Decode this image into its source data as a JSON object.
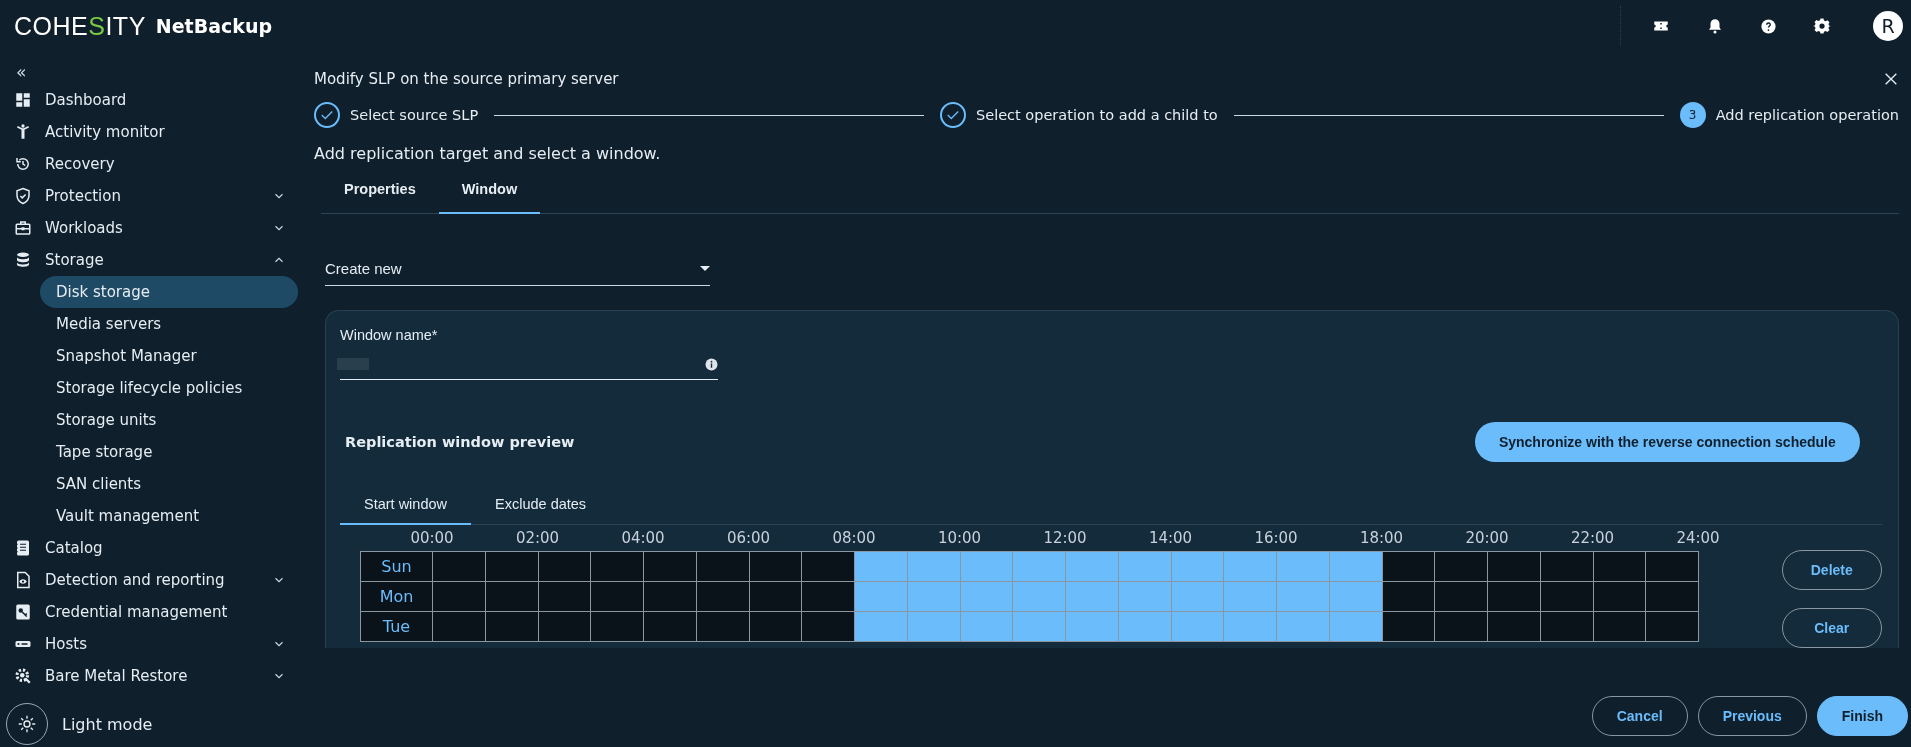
{
  "header": {
    "logo": "COHESITY",
    "product": "NetBackup",
    "avatar": "R"
  },
  "sidebar": {
    "collapse": "«",
    "items": [
      {
        "label": "Dashboard"
      },
      {
        "label": "Activity monitor"
      },
      {
        "label": "Recovery"
      },
      {
        "label": "Protection",
        "expanded": false
      },
      {
        "label": "Workloads",
        "expanded": false
      },
      {
        "label": "Storage",
        "expanded": true,
        "children": [
          {
            "label": "Disk storage",
            "selected": true
          },
          {
            "label": "Media servers",
            "selected": false
          },
          {
            "label": "Snapshot Manager",
            "selected": false
          },
          {
            "label": "Storage lifecycle policies",
            "selected": false
          },
          {
            "label": "Storage units",
            "selected": false
          },
          {
            "label": "Tape storage",
            "selected": false
          },
          {
            "label": "SAN clients",
            "selected": false
          },
          {
            "label": "Vault management",
            "selected": false
          }
        ]
      },
      {
        "label": "Catalog"
      },
      {
        "label": "Detection and reporting",
        "expanded": false
      },
      {
        "label": "Credential management"
      },
      {
        "label": "Hosts",
        "expanded": false
      },
      {
        "label": "Bare Metal Restore",
        "expanded": false
      }
    ],
    "theme_toggle": "Light mode"
  },
  "wizard": {
    "title": "Modify SLP on the source primary server",
    "steps": [
      {
        "label": "Select source SLP",
        "completed": true
      },
      {
        "label": "Select operation to add a child to",
        "completed": true
      },
      {
        "label": "Add replication operation",
        "completed": false,
        "number": "3"
      }
    ],
    "subtitle": "Add replication target and select a window.",
    "tabs": [
      {
        "label": "Properties",
        "selected": false
      },
      {
        "label": "Window",
        "selected": true
      }
    ],
    "window_select": {
      "value": "Create new"
    },
    "window_name": {
      "label": "Window name*"
    },
    "preview_title": "Replication window preview",
    "sync_button": "Synchronize with the reverse connection schedule",
    "inner_tabs": [
      {
        "label": "Start window",
        "selected": true
      },
      {
        "label": "Exclude dates",
        "selected": false
      }
    ],
    "grid": {
      "hours": [
        "00:00",
        "02:00",
        "04:00",
        "06:00",
        "08:00",
        "10:00",
        "12:00",
        "14:00",
        "16:00",
        "18:00",
        "20:00",
        "22:00",
        "24:00"
      ],
      "rows": [
        {
          "day": "Sun",
          "slots": [
            false,
            false,
            false,
            false,
            false,
            false,
            false,
            false,
            true,
            true,
            true,
            true,
            true,
            true,
            true,
            true,
            true,
            true,
            false,
            false,
            false,
            false,
            false,
            false
          ]
        },
        {
          "day": "Mon",
          "slots": [
            false,
            false,
            false,
            false,
            false,
            false,
            false,
            false,
            true,
            true,
            true,
            true,
            true,
            true,
            true,
            true,
            true,
            true,
            false,
            false,
            false,
            false,
            false,
            false
          ]
        },
        {
          "day": "Tue",
          "slots": [
            false,
            false,
            false,
            false,
            false,
            false,
            false,
            false,
            true,
            true,
            true,
            true,
            true,
            true,
            true,
            true,
            true,
            true,
            false,
            false,
            false,
            false,
            false,
            false
          ]
        }
      ]
    },
    "grid_buttons": [
      "Delete",
      "Clear"
    ],
    "footer_buttons": [
      {
        "label": "Cancel",
        "primary": false
      },
      {
        "label": "Previous",
        "primary": false
      },
      {
        "label": "Finish",
        "primary": true
      }
    ]
  }
}
